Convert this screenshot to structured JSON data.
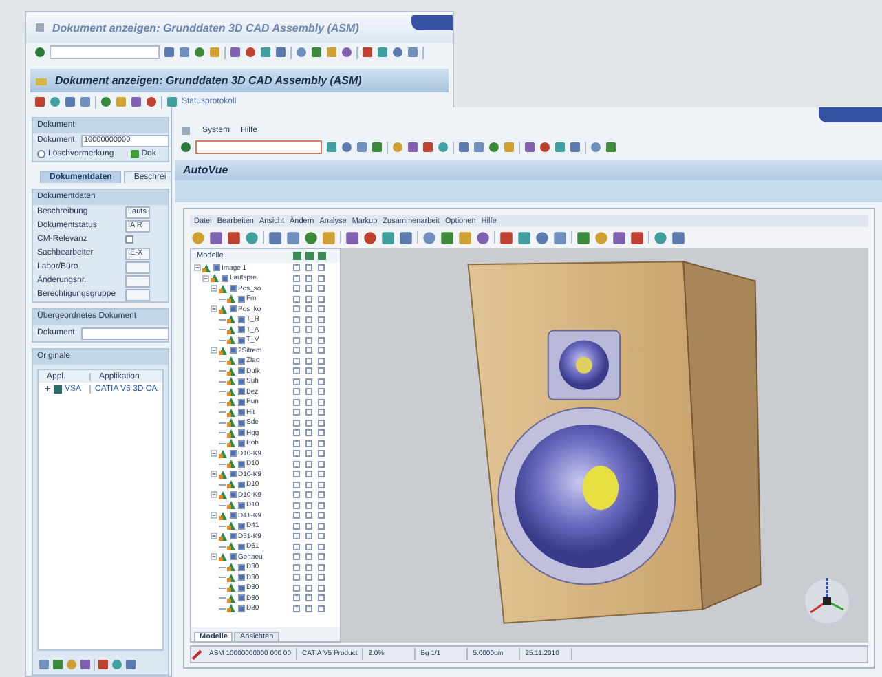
{
  "back_window": {
    "title": "Dokument anzeigen: Grunddaten  3D CAD Assembly (ASM)",
    "header": "Dokument anzeigen: Grunddaten  3D CAD Assembly (ASM)",
    "toolbar_link": "Statusprotokoll",
    "document_group": {
      "title": "Dokument",
      "label": "Dokument",
      "value": "10000000000",
      "deletion_flag": {
        "label": "Löschvormerkung",
        "selected": false
      },
      "status_label": "Dok"
    },
    "tabs": [
      {
        "label": "Dokumentdaten",
        "selected": true
      },
      {
        "label": "Beschrei",
        "selected": false
      }
    ],
    "document_data": {
      "title": "Dokumentdaten",
      "fields": [
        {
          "kind": "text",
          "label": "Beschreibung",
          "value": "Lauts"
        },
        {
          "kind": "text",
          "label": "Dokumentstatus",
          "value": "IA R"
        },
        {
          "kind": "checkbox",
          "label": "CM-Relevanz",
          "checked": false
        },
        {
          "kind": "text",
          "label": "Sachbearbeiter",
          "value": "IE-X"
        },
        {
          "kind": "text",
          "label": "Labor/Büro"
        },
        {
          "kind": "text",
          "label": "Änderungsnr."
        },
        {
          "kind": "text",
          "label": "Berechtigungsgruppe"
        }
      ]
    },
    "parent_document": {
      "title": "Übergeordnetes Dokument",
      "label": "Dokument"
    },
    "originals": {
      "title": "Originale",
      "columns": [
        "Appl.",
        "Applikation"
      ],
      "rows": [
        {
          "expanded": false,
          "cells": [
            "VSA",
            "CATIA V5 3D CA"
          ]
        }
      ]
    }
  },
  "front_window": {
    "menu": [
      "System",
      "Hilfe"
    ],
    "header": "AutoVue",
    "viewer": {
      "menu": [
        "Datei",
        "Bearbeiten",
        "Ansicht",
        "Ändern",
        "Analyse",
        "Markup",
        "Zusammenarbeit",
        "Optionen",
        "Hilfe"
      ],
      "tree_title": "Modelle",
      "nodes": [
        {
          "label": "Image 1",
          "expanded": true,
          "checked": true,
          "flags": [
            false,
            false,
            false
          ],
          "children": [
            {
              "label": "Lautspre",
              "expanded": true,
              "checked": true,
              "flags": [
                false,
                false,
                false
              ],
              "children": [
                {
                  "label": "Pos_so",
                  "expanded": true,
                  "checked": true,
                  "flags": [
                    false,
                    false,
                    false
                  ],
                  "children": [
                    {
                      "label": "Fm",
                      "checked": true,
                      "flags": [
                        false,
                        false,
                        false
                      ]
                    }
                  ]
                },
                {
                  "label": "Pos_ko",
                  "expanded": true,
                  "checked": true,
                  "flags": [
                    false,
                    false,
                    false
                  ],
                  "children": [
                    {
                      "label": "T_R",
                      "checked": true,
                      "flags": [
                        false,
                        false,
                        false
                      ]
                    },
                    {
                      "label": "T_A",
                      "checked": true,
                      "flags": [
                        false,
                        false,
                        false
                      ]
                    },
                    {
                      "label": "T_V",
                      "checked": true,
                      "flags": [
                        false,
                        false,
                        false
                      ]
                    }
                  ]
                },
                {
                  "label": "2Sitrem",
                  "expanded": true,
                  "checked": true,
                  "flags": [
                    false,
                    false,
                    false
                  ],
                  "children": [
                    {
                      "label": "Zlag",
                      "checked": true,
                      "flags": [
                        false,
                        false,
                        false
                      ]
                    },
                    {
                      "label": "Dulk",
                      "checked": true,
                      "flags": [
                        false,
                        false,
                        false
                      ]
                    },
                    {
                      "label": "Suh",
                      "checked": true,
                      "flags": [
                        false,
                        false,
                        false
                      ]
                    },
                    {
                      "label": "Bez",
                      "checked": true,
                      "flags": [
                        false,
                        false,
                        false
                      ]
                    },
                    {
                      "label": "Pun",
                      "checked": true,
                      "flags": [
                        false,
                        false,
                        false
                      ]
                    },
                    {
                      "label": "Hit",
                      "checked": true,
                      "flags": [
                        false,
                        false,
                        false
                      ]
                    },
                    {
                      "label": "Sde",
                      "checked": true,
                      "flags": [
                        false,
                        false,
                        false
                      ]
                    },
                    {
                      "label": "Hgg",
                      "checked": true,
                      "flags": [
                        false,
                        false,
                        false
                      ]
                    },
                    {
                      "label": "Pob",
                      "checked": true,
                      "flags": [
                        false,
                        false,
                        false
                      ]
                    }
                  ]
                },
                {
                  "label": "D10-K9",
                  "expanded": true,
                  "checked": true,
                  "flags": [
                    false,
                    false,
                    false
                  ],
                  "children": [
                    {
                      "label": "D10",
                      "checked": true,
                      "flags": [
                        false,
                        false,
                        false
                      ]
                    }
                  ]
                },
                {
                  "label": "D10-K9",
                  "expanded": true,
                  "checked": true,
                  "flags": [
                    false,
                    false,
                    false
                  ],
                  "children": [
                    {
                      "label": "D10",
                      "checked": true,
                      "flags": [
                        false,
                        false,
                        false
                      ]
                    }
                  ]
                },
                {
                  "label": "D10-K9",
                  "expanded": true,
                  "checked": true,
                  "flags": [
                    false,
                    false,
                    false
                  ],
                  "children": [
                    {
                      "label": "D10",
                      "checked": true,
                      "flags": [
                        false,
                        false,
                        false
                      ]
                    }
                  ]
                },
                {
                  "label": "D41-K9",
                  "expanded": true,
                  "checked": true,
                  "flags": [
                    false,
                    false,
                    false
                  ],
                  "children": [
                    {
                      "label": "D41",
                      "checked": true,
                      "flags": [
                        false,
                        false,
                        false
                      ]
                    }
                  ]
                },
                {
                  "label": "D51-K9",
                  "expanded": true,
                  "checked": true,
                  "flags": [
                    false,
                    false,
                    false
                  ],
                  "children": [
                    {
                      "label": "D51",
                      "checked": true,
                      "flags": [
                        false,
                        false,
                        false
                      ]
                    }
                  ]
                },
                {
                  "label": "Gehaeu",
                  "expanded": true,
                  "checked": true,
                  "flags": [
                    false,
                    false,
                    false
                  ],
                  "children": [
                    {
                      "label": "D30",
                      "checked": true,
                      "flags": [
                        false,
                        false,
                        false
                      ]
                    },
                    {
                      "label": "D30",
                      "checked": true,
                      "flags": [
                        false,
                        false,
                        false
                      ]
                    },
                    {
                      "label": "D30",
                      "checked": true,
                      "flags": [
                        false,
                        false,
                        false
                      ]
                    },
                    {
                      "label": "D30",
                      "checked": true,
                      "flags": [
                        false,
                        false,
                        false
                      ]
                    },
                    {
                      "label": "D30",
                      "checked": true,
                      "flags": [
                        false,
                        false,
                        false
                      ]
                    }
                  ]
                }
              ]
            }
          ]
        }
      ],
      "tabs": [
        {
          "label": "Modelle",
          "selected": true
        },
        {
          "label": "Ansichten",
          "selected": false
        }
      ],
      "status": [
        "ASM 10000000000 000 00",
        "CATIA V5 Product",
        "2.0%",
        "Bg 1/1",
        "5.0000cm",
        "25.11.2010"
      ]
    }
  }
}
